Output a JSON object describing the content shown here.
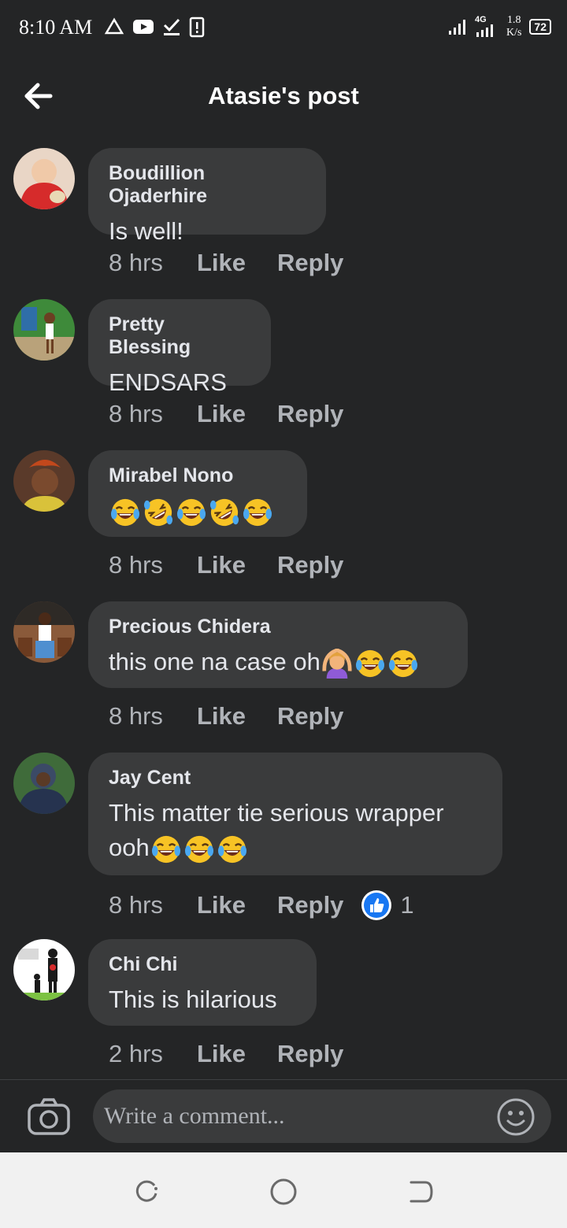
{
  "status_bar": {
    "time": "8:10 AM",
    "network_type": "4G",
    "speed_value": "1.8",
    "speed_unit": "K/s",
    "battery": "72"
  },
  "header": {
    "title": "Atasie's post"
  },
  "comments": [
    {
      "author": "Boudillion Ojaderhire",
      "text": "Is well!",
      "time": "8 hrs",
      "like_label": "Like",
      "reply_label": "Reply"
    },
    {
      "author": "Pretty Blessing",
      "text": "ENDSARS",
      "time": "8 hrs",
      "like_label": "Like",
      "reply_label": "Reply"
    },
    {
      "author": "Mirabel Nono",
      "text": "",
      "time": "8 hrs",
      "like_label": "Like",
      "reply_label": "Reply"
    },
    {
      "author": "Precious Chidera",
      "text": "this one na case oh",
      "time": "8 hrs",
      "like_label": "Like",
      "reply_label": "Reply"
    },
    {
      "author": "Jay Cent",
      "text": "This matter tie serious wrapper",
      "text2": "ooh",
      "time": "8 hrs",
      "like_label": "Like",
      "reply_label": "Reply",
      "reaction_count": "1"
    },
    {
      "author": "Chi Chi",
      "text": "This is hilarious",
      "time": "2 hrs",
      "like_label": "Like",
      "reply_label": "Reply"
    }
  ],
  "composer": {
    "placeholder": "Write a comment..."
  },
  "colors": {
    "background": "#242526",
    "bubble": "#3a3b3c",
    "like_blue": "#1877f2"
  }
}
